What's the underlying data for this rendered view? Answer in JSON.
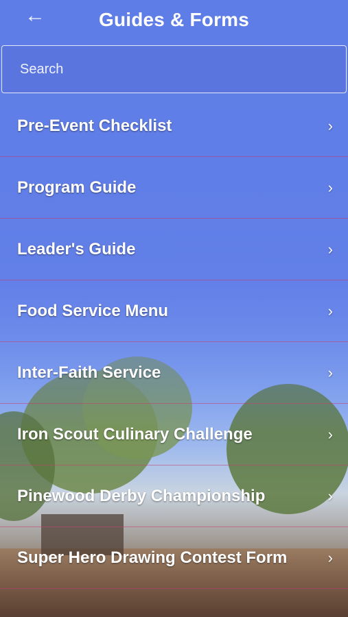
{
  "header": {
    "title": "Guides & Forms",
    "back_icon": "←"
  },
  "search": {
    "placeholder": "Search"
  },
  "menu": {
    "chevron": "›",
    "items": [
      {
        "label": "Pre-Event Checklist"
      },
      {
        "label": "Program Guide"
      },
      {
        "label": "Leader's Guide"
      },
      {
        "label": "Food Service Menu"
      },
      {
        "label": "Inter-Faith Service"
      },
      {
        "label": "Iron Scout Culinary Challenge"
      },
      {
        "label": "Pinewood Derby Championship"
      },
      {
        "label": "Super Hero Drawing Contest Form"
      }
    ]
  },
  "colors": {
    "accent": "#5f7ce8",
    "divider": "#c83c6e"
  }
}
